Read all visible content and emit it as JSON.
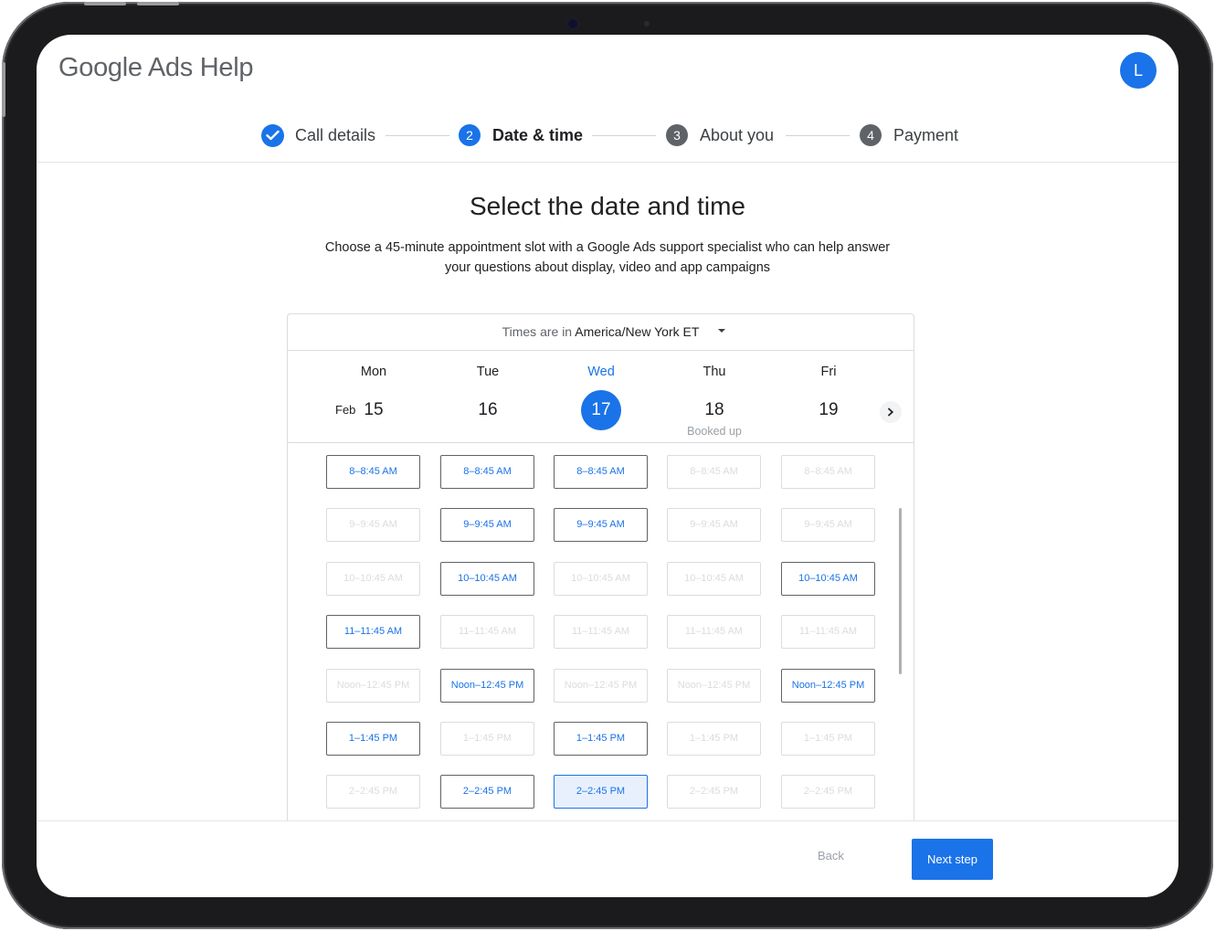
{
  "brand": {
    "google": "Google",
    "product": "Ads Help"
  },
  "user": {
    "initial": "L"
  },
  "steps": [
    {
      "label": "Call details",
      "state": "done"
    },
    {
      "num": "2",
      "label": "Date & time",
      "state": "active"
    },
    {
      "num": "3",
      "label": "About you",
      "state": "pending"
    },
    {
      "num": "4",
      "label": "Payment",
      "state": "pending"
    }
  ],
  "page": {
    "title": "Select the date and time",
    "description_line1": "Choose a 45-minute appointment slot with a Google Ads support specialist who can help answer",
    "description_line2": "your questions about display, video and app campaigns"
  },
  "timezone": {
    "prefix": "Times are in",
    "value": "America/New York ET"
  },
  "month": "Feb",
  "days": [
    {
      "name": "Mon",
      "date": "15",
      "note": "",
      "selected": false
    },
    {
      "name": "Tue",
      "date": "16",
      "note": "",
      "selected": false
    },
    {
      "name": "Wed",
      "date": "17",
      "note": "",
      "selected": true
    },
    {
      "name": "Thu",
      "date": "18",
      "note": "Booked up",
      "selected": false
    },
    {
      "name": "Fri",
      "date": "19",
      "note": "",
      "selected": false
    }
  ],
  "slots": [
    {
      "label": "8–8:45 AM",
      "avail": [
        true,
        true,
        true,
        false,
        false
      ]
    },
    {
      "label": "9–9:45 AM",
      "avail": [
        false,
        true,
        true,
        false,
        false
      ]
    },
    {
      "label": "10–10:45 AM",
      "avail": [
        false,
        true,
        false,
        false,
        true
      ]
    },
    {
      "label": "11–11:45 AM",
      "avail": [
        true,
        false,
        false,
        false,
        false
      ]
    },
    {
      "label": "Noon–12:45 PM",
      "avail": [
        false,
        true,
        false,
        false,
        true
      ]
    },
    {
      "label": "1–1:45 PM",
      "avail": [
        true,
        false,
        true,
        false,
        false
      ]
    },
    {
      "label": "2–2:45 PM",
      "avail": [
        false,
        true,
        true,
        false,
        false
      ]
    }
  ],
  "selected_slot": {
    "day": "Wed",
    "time": "2–2:45 PM"
  },
  "footer": {
    "back_label": "Back",
    "next_label": "Next step"
  },
  "colors": {
    "accent": "#1a73e8",
    "disabled": "#dadce0"
  }
}
